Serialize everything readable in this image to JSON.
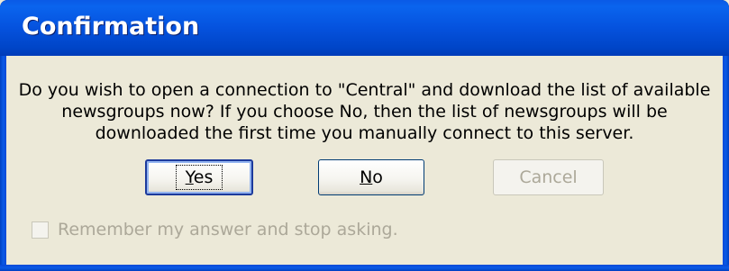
{
  "window": {
    "title": "Confirmation"
  },
  "message": {
    "line1": "Do you wish to open a connection to \"Central\" and download the list of available",
    "line2": "newsgroups now? If you choose No, then the list of newsgroups will be",
    "line3": "downloaded the first time you manually connect to this server."
  },
  "buttons": {
    "yes": {
      "mnemonic": "Y",
      "rest": "es",
      "state": "default"
    },
    "no": {
      "mnemonic": "N",
      "rest": "o",
      "state": "enabled"
    },
    "cancel": {
      "label": "Cancel",
      "state": "disabled"
    }
  },
  "remember": {
    "label": "Remember my answer and stop asking.",
    "checked": false,
    "state": "disabled"
  },
  "colors": {
    "titlebar": "#0552de",
    "dialog_bg": "#ece9d8",
    "disabled_text": "#aca899"
  }
}
